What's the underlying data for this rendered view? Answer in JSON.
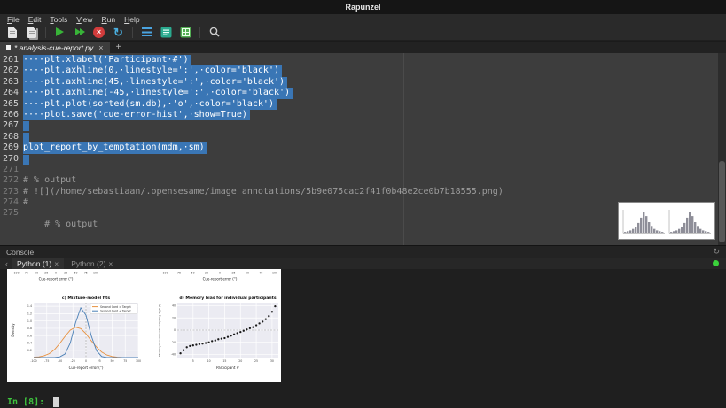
{
  "window": {
    "title": "Rapunzel"
  },
  "menubar": {
    "items": [
      "File",
      "Edit",
      "Tools",
      "View",
      "Run",
      "Help"
    ]
  },
  "toolbar": {
    "icons": [
      "new-file",
      "open-file",
      "run-file",
      "run-selection",
      "stop-kernel",
      "restart-kernel",
      "toggle-console",
      "run-cell",
      "variable-inspector",
      "search"
    ]
  },
  "glyphs": {
    "close": "×",
    "stop": "×",
    "restart": "↻",
    "refresh": "↻",
    "chev_left": "‹",
    "add": "+"
  },
  "tabs": {
    "items": [
      {
        "label": "* analysis-cue-report.py",
        "close": "×"
      }
    ],
    "add_label": "+"
  },
  "editor": {
    "lines": [
      {
        "no": "261",
        "text": "····plt.xlabel('Participant·#')",
        "selected": true
      },
      {
        "no": "262",
        "text": "····plt.axhline(0,·linestyle=':',·color='black')",
        "selected": true
      },
      {
        "no": "263",
        "text": "····plt.axhline(45,·linestyle=':',·color='black')",
        "selected": true
      },
      {
        "no": "264",
        "text": "····plt.axhline(-45,·linestyle=':',·color='black')",
        "selected": true
      },
      {
        "no": "265",
        "text": "····plt.plot(sorted(sm.db),·'o',·color='black')",
        "selected": true
      },
      {
        "no": "266",
        "text": "····plot.save('cue-error-hist',·show=True)",
        "selected": true
      },
      {
        "no": "267",
        "text": "",
        "selected": true
      },
      {
        "no": "268",
        "text": "",
        "selected": true
      },
      {
        "no": "269",
        "text": "plot_report_by_temptation(mdm,·sm)",
        "selected": true
      },
      {
        "no": "270",
        "text": "",
        "selected": true
      },
      {
        "no": "271",
        "text": "",
        "selected": false
      },
      {
        "no": "272",
        "text": "# % output",
        "selected": false
      },
      {
        "no": "273",
        "text": "# ![](/home/sebastiaan/.opensesame/image_annotations/5b9e075cac2f41f0b48e2ce0b7b18555.png)",
        "selected": false
      },
      {
        "no": "274",
        "text": "#",
        "selected": false
      },
      {
        "no": "275",
        "text": "",
        "selected": false
      },
      {
        "no": "",
        "text": "    # % output",
        "selected": false
      }
    ]
  },
  "console": {
    "title": "Console",
    "tabs": [
      {
        "label": "Python (1)",
        "close": "×",
        "active": true
      },
      {
        "label": "Python (2)",
        "close": "×",
        "active": false
      }
    ],
    "prompt": "In [8]: "
  },
  "annotation_preview": {
    "bars": [
      1,
      2,
      3,
      5,
      8,
      13,
      20,
      28,
      22,
      14,
      9,
      5,
      3,
      2,
      1
    ]
  },
  "figure": {
    "top_axes": {
      "xlabel": "Cue-report error (°)",
      "xticks": [
        -100,
        -75,
        -50,
        -25,
        0,
        25,
        50,
        75,
        100
      ]
    },
    "mixture": {
      "type": "line",
      "title": "c) Mixture-model fits",
      "xlabel": "Cue-report error (°)",
      "ylabel": "Density",
      "xlim": [
        -100,
        100
      ],
      "ylim": [
        0,
        1.5
      ],
      "xticks": [
        -100,
        -75,
        -50,
        -25,
        0,
        25,
        50,
        75,
        100
      ],
      "yticks": [
        0.2,
        0.4,
        0.6,
        0.8,
        1.0,
        1.2,
        1.4
      ],
      "x": [
        -100,
        -90,
        -80,
        -70,
        -60,
        -50,
        -40,
        -30,
        -20,
        -10,
        0,
        10,
        20,
        30,
        40,
        50,
        60,
        70,
        80,
        90,
        100
      ],
      "series": [
        {
          "name": "Second Card > Target",
          "color": "#e8913f",
          "values": [
            0.01,
            0.02,
            0.05,
            0.11,
            0.22,
            0.39,
            0.58,
            0.75,
            0.83,
            0.79,
            0.65,
            0.46,
            0.29,
            0.15,
            0.07,
            0.03,
            0.01,
            0,
            0,
            0,
            0
          ]
        },
        {
          "name": "Second Card < Target",
          "color": "#4a7fb5",
          "values": [
            0,
            0,
            0,
            0,
            0,
            0.02,
            0.1,
            0.4,
            0.95,
            1.36,
            1.16,
            0.6,
            0.19,
            0.03,
            0,
            0,
            0,
            0,
            0,
            0,
            0
          ]
        }
      ]
    },
    "bias": {
      "type": "scatter",
      "title": "d) Memory bias for individual participants",
      "xlabel": "Participant #",
      "ylabel": "Memory bias towards tempting digit (°)",
      "xlim": [
        0,
        32
      ],
      "ylim": [
        -45,
        45
      ],
      "xticks": [
        5,
        10,
        15,
        20,
        25,
        30
      ],
      "yticks": [
        -40,
        -20,
        0,
        20,
        40
      ],
      "values": [
        -38,
        -33,
        -28,
        -26,
        -25,
        -24,
        -23,
        -22,
        -21,
        -20,
        -18,
        -17,
        -15,
        -14,
        -13,
        -11,
        -9,
        -7,
        -5,
        -3,
        -1,
        1,
        3,
        5,
        8,
        11,
        14,
        18,
        23,
        30,
        39
      ]
    }
  }
}
